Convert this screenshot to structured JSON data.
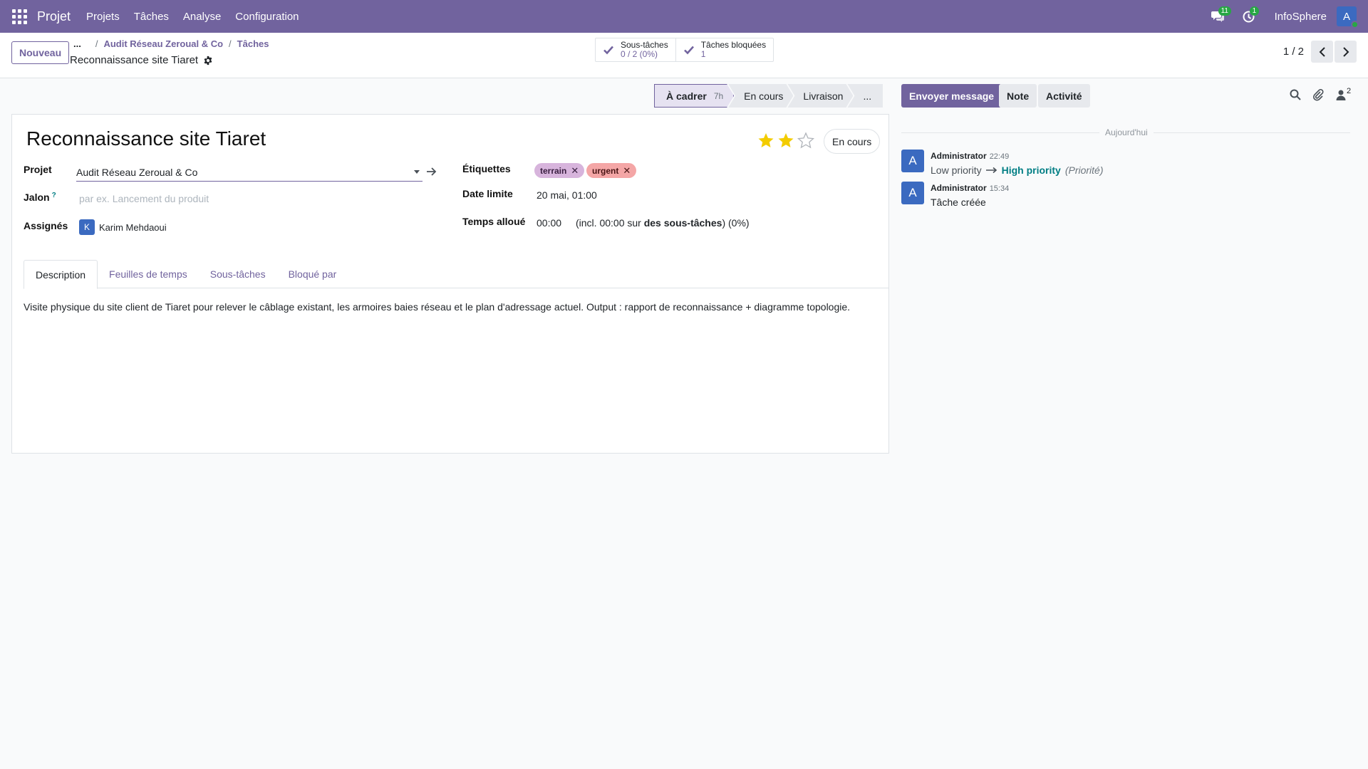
{
  "navbar": {
    "app_name": "Projet",
    "menu": [
      "Projets",
      "Tâches",
      "Analyse",
      "Configuration"
    ],
    "messages_badge": "11",
    "activities_badge": "1",
    "company": "InfoSphere",
    "user_initial": "A",
    "brand_color": "#71639e"
  },
  "control": {
    "new_label": "Nouveau",
    "breadcrumb_dots": "...",
    "breadcrumb": [
      "Audit Réseau Zeroual & Co",
      "Tâches"
    ],
    "record_name": "Reconnaissance site Tiaret",
    "smart_buttons": [
      {
        "label": "Sous-tâches",
        "value": "0 / 2 (0%)"
      },
      {
        "label": "Tâches bloquées",
        "value": "1"
      }
    ],
    "pager": "1 / 2"
  },
  "statusbar": {
    "stages": [
      {
        "label": "À cadrer",
        "duration": "7h"
      },
      {
        "label": "En cours"
      },
      {
        "label": "Livraison"
      },
      {
        "label": "..."
      }
    ]
  },
  "form": {
    "title": "Reconnaissance site Tiaret",
    "priority_stars_filled": 2,
    "priority_stars_total": 3,
    "state_button": "En cours",
    "project_label": "Projet",
    "project_value": "Audit Réseau Zeroual & Co",
    "milestone_label": "Jalon",
    "milestone_help": "?",
    "milestone_placeholder": "par ex. Lancement du produit",
    "assignees_label": "Assignés",
    "assignee_initial": "K",
    "assignee_name": "Karim Mehdaoui",
    "tags_label": "Étiquettes",
    "tags": [
      "terrain",
      "urgent"
    ],
    "tag_colors": [
      "#d7b4dc",
      "#f4a6a6"
    ],
    "deadline_label": "Date limite",
    "deadline_value": "20 mai, 01:00",
    "allocated_label": "Temps alloué",
    "allocated_value": "00:00",
    "allocated_incl_prefix": "(incl. 00:00 sur",
    "allocated_incl_bold": "des sous-tâches",
    "allocated_incl_suffix": ") (0%)"
  },
  "tabs": [
    "Description",
    "Feuilles de temps",
    "Sous-tâches",
    "Bloqué par"
  ],
  "description": "Visite physique du site client de Tiaret pour relever le câblage existant, les armoires baies réseau et le plan d'adressage actuel. Output : rapport de reconnaissance + diagramme topologie.",
  "chatter": {
    "send_message": "Envoyer message",
    "note": "Note",
    "activity": "Activité",
    "followers_count": "2",
    "today_label": "Aujourd'hui",
    "messages": [
      {
        "initial": "A",
        "author": "Administrator",
        "time": "22:49",
        "old_value": "Low priority",
        "new_value": "High priority",
        "field": "(Priorité)"
      },
      {
        "initial": "A",
        "author": "Administrator",
        "time": "15:34",
        "body": "Tâche créée"
      }
    ]
  }
}
